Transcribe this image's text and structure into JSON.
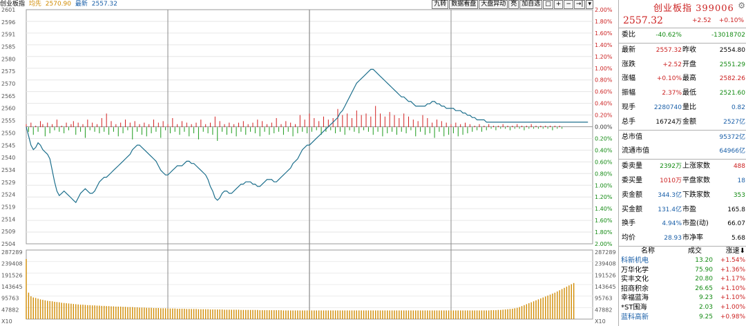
{
  "header": {
    "index_label": "创业板指",
    "prev_label": "均先",
    "prev_value": "2570.90",
    "latest_label": "最新",
    "latest_value": "2557.32"
  },
  "toolbar": [
    "九转",
    "数据看盘",
    "大盘异动",
    "亮",
    "加自选",
    "□",
    "+",
    "−",
    "→|",
    "▾"
  ],
  "axis": {
    "price_ticks": [
      "2601",
      "2596",
      "2591",
      "2585",
      "2580",
      "2575",
      "2570",
      "2565",
      "2560",
      "2555",
      "2550",
      "2545",
      "2540",
      "2534",
      "2529",
      "2524",
      "2519",
      "2514",
      "2509",
      "2504"
    ],
    "pct_left": [
      "2.00%",
      "1.80%",
      "1.60%",
      "1.40%",
      "1.20%",
      "1.00%",
      "0.80%",
      "0.60%",
      "0.40%",
      "0.20%",
      "0.00%",
      "0.20%",
      "0.40%",
      "0.60%",
      "0.80%",
      "1.00%",
      "1.20%",
      "1.40%",
      "1.60%",
      "1.80%",
      "2.00%"
    ],
    "vol_ticks": [
      "287289",
      "239408",
      "191526",
      "143645",
      "95763",
      "47882",
      "X10"
    ]
  },
  "chart_data": {
    "type": "line",
    "title": "",
    "x_range_points": 241,
    "ylim": [
      2504,
      2606
    ],
    "prev_close": 2554.8,
    "volume_ylim": [
      0,
      287289
    ],
    "series": [
      {
        "values": [
          2555,
          2551,
          2547,
          2545,
          2546,
          2548,
          2547,
          2545,
          2544,
          2543,
          2541,
          2536,
          2531,
          2527,
          2525,
          2526,
          2527,
          2526,
          2525,
          2524,
          2523,
          2522,
          2524,
          2526,
          2527,
          2528,
          2527,
          2526,
          2526,
          2527,
          2529,
          2531,
          2532,
          2533,
          2533,
          2534,
          2535,
          2536,
          2537,
          2538,
          2539,
          2540,
          2541,
          2542,
          2543,
          2545,
          2546,
          2547,
          2547,
          2546,
          2545,
          2544,
          2543,
          2542,
          2541,
          2540,
          2538,
          2536,
          2535,
          2534,
          2534,
          2535,
          2536,
          2537,
          2538,
          2538,
          2538,
          2539,
          2540,
          2540,
          2539,
          2539,
          2538,
          2537,
          2536,
          2535,
          2534,
          2532,
          2529,
          2527,
          2524,
          2523,
          2524,
          2526,
          2527,
          2527,
          2526,
          2526,
          2527,
          2528,
          2529,
          2530,
          2530,
          2531,
          2531,
          2531,
          2530,
          2530,
          2529,
          2529,
          2530,
          2531,
          2532,
          2532,
          2532,
          2531,
          2531,
          2532,
          2533,
          2534,
          2535,
          2536,
          2537,
          2539,
          2540,
          2541,
          2543,
          2545,
          2546,
          2547,
          2547,
          2548,
          2549,
          2550,
          2551,
          2552,
          2553,
          2554,
          2555,
          2556,
          2557,
          2558,
          2559,
          2561,
          2562,
          2564,
          2566,
          2568,
          2570,
          2572,
          2574,
          2575,
          2576,
          2577,
          2578,
          2579,
          2580,
          2580,
          2579,
          2578,
          2577,
          2576,
          2575,
          2574,
          2573,
          2572,
          2571,
          2570,
          2569,
          2568,
          2568,
          2567,
          2566,
          2566,
          2565,
          2564,
          2564,
          2564,
          2564,
          2564,
          2565,
          2565,
          2566,
          2566,
          2565,
          2565,
          2564,
          2564,
          2563,
          2563,
          2563,
          2563,
          2562,
          2562,
          2562,
          2561,
          2561,
          2560,
          2560,
          2559,
          2559,
          2558,
          2558,
          2558,
          2558,
          2557,
          2557,
          2557,
          2557,
          2557,
          2557,
          2557,
          2557,
          2557,
          2557,
          2557,
          2557,
          2557,
          2557,
          2557,
          2557,
          2557,
          2557,
          2557,
          2557,
          2557,
          2557,
          2557,
          2557,
          2557,
          2557,
          2557,
          2557,
          2557,
          2557,
          2557,
          2557,
          2557,
          2557,
          2557,
          2557,
          2557,
          2557,
          2557,
          2557,
          2557,
          2557,
          2557,
          2557
        ]
      }
    ],
    "breadth_bars": [
      2,
      -3,
      3,
      -5,
      1,
      -3,
      4,
      2,
      -6,
      3,
      -4,
      2,
      -2,
      5,
      -3,
      1,
      -4,
      3,
      -2,
      2,
      4,
      -5,
      3,
      -3,
      2,
      -7,
      5,
      -2,
      3,
      -3,
      2,
      -4,
      6,
      -3,
      9,
      -5,
      4,
      -3,
      2,
      -6,
      3,
      -4,
      5,
      -2,
      3,
      -8,
      4,
      -3,
      2,
      -5,
      3,
      -6,
      2,
      -4,
      5,
      -3,
      3,
      -7,
      4,
      -2,
      2,
      -4,
      6,
      -3,
      2,
      -5,
      4,
      -3,
      3,
      -6,
      2,
      -4,
      3,
      -8,
      5,
      -3,
      2,
      -4,
      3,
      -5,
      7,
      -9,
      4,
      -3,
      2,
      -5,
      3,
      -4,
      2,
      -6,
      3,
      -3,
      4,
      -5,
      2,
      -3,
      3,
      -4,
      5,
      -6,
      4,
      -3,
      2,
      -5,
      3,
      -4,
      6,
      -3,
      2,
      -5,
      4,
      -3,
      3,
      -6,
      2,
      -4,
      8,
      -3,
      5,
      -4,
      9,
      -3,
      6,
      -2,
      4,
      -5,
      7,
      -3,
      5,
      -2,
      6,
      -4,
      12,
      -3,
      8,
      -5,
      9,
      -2,
      6,
      -3,
      11,
      -4,
      8,
      -2,
      9,
      -3,
      7,
      -5,
      14,
      -3,
      9,
      -6,
      7,
      -4,
      10,
      -3,
      8,
      -5,
      6,
      -3,
      9,
      -4,
      7,
      -2,
      5,
      -6,
      4,
      -3,
      8,
      -5,
      6,
      -4,
      3,
      -7,
      5,
      -3,
      4,
      -6,
      3,
      -5,
      2,
      -4,
      3,
      -6,
      2,
      -5,
      3,
      -4,
      2,
      -3,
      1,
      -2,
      2,
      -3,
      1,
      -2,
      2,
      -1,
      1,
      -2,
      1,
      -1,
      2,
      -1,
      1,
      -2,
      1,
      -1,
      2,
      -1,
      1,
      -2,
      1,
      -1,
      2,
      -1,
      1,
      -1,
      1,
      -1,
      1,
      -1,
      1,
      -2,
      1,
      -1,
      1,
      -1
    ],
    "volumes": [
      250000,
      110000,
      95000,
      90000,
      88000,
      85000,
      82000,
      80000,
      78000,
      76000,
      75000,
      74000,
      72000,
      71000,
      70000,
      68000,
      67000,
      66000,
      65000,
      64000,
      63000,
      62000,
      61000,
      60000,
      60000,
      59000,
      58000,
      58000,
      57000,
      57000,
      56000,
      56000,
      55000,
      55000,
      54000,
      54000,
      53000,
      53000,
      52000,
      52000,
      52000,
      51000,
      51000,
      50000,
      50000,
      50000,
      49000,
      49000,
      48000,
      48000,
      48000,
      47000,
      47000,
      47000,
      46000,
      46000,
      46000,
      45000,
      45000,
      45000,
      44000,
      44000,
      44000,
      44000,
      43000,
      43000,
      43000,
      43000,
      42000,
      42000,
      42000,
      42000,
      42000,
      41000,
      41000,
      41000,
      41000,
      41000,
      40000,
      40000,
      40000,
      40000,
      40000,
      40000,
      39000,
      39000,
      39000,
      39000,
      39000,
      39000,
      39000,
      38000,
      38000,
      38000,
      38000,
      38000,
      38000,
      38000,
      38000,
      37000,
      37000,
      37000,
      37000,
      37000,
      37000,
      37000,
      37000,
      37000,
      37000,
      36000,
      36000,
      36000,
      36000,
      36000,
      36000,
      36000,
      36000,
      36000,
      36000,
      36000,
      36000,
      36000,
      36000,
      36000,
      36000,
      36000,
      36000,
      36000,
      36000,
      36000,
      36000,
      36000,
      36000,
      36000,
      36000,
      36000,
      36000,
      36000,
      36000,
      36000,
      36000,
      36000,
      36000,
      36000,
      36000,
      36000,
      36000,
      36000,
      36000,
      36000,
      36000,
      36000,
      36000,
      36000,
      36000,
      36000,
      36000,
      36000,
      36000,
      36000,
      36000,
      36000,
      36000,
      36000,
      36000,
      36000,
      36000,
      36000,
      36000,
      36000,
      36000,
      36000,
      36000,
      36000,
      36000,
      36000,
      36000,
      36000,
      36000,
      36000,
      36000,
      36000,
      36000,
      36000,
      36000,
      36000,
      36000,
      36000,
      36000,
      36000,
      36000,
      36000,
      36000,
      36000,
      36000,
      36000,
      36000,
      37000,
      37000,
      37000,
      38000,
      38000,
      39000,
      40000,
      41000,
      42000,
      43000,
      45000,
      47000,
      50000,
      54000,
      58000,
      62000,
      66000,
      70000,
      74000,
      78000,
      82000,
      86000,
      90000,
      94000,
      98000,
      102000,
      106000,
      110000,
      115000,
      120000,
      125000,
      130000,
      135000,
      140000,
      145000,
      150000
    ]
  },
  "panel": {
    "title": "创业板指 399006",
    "last": "2557.32",
    "change": "+2.52",
    "change_pct": "+0.10%",
    "weibi_label": "委比",
    "weibi_pct": "-40.62%",
    "weibi_val": "-13018702",
    "rows1": [
      {
        "l1": "最新",
        "v1": "2557.32",
        "c1": "red",
        "l2": "昨收",
        "v2": "2554.80",
        "c2": "blk"
      },
      {
        "l1": "涨跌",
        "v1": "+2.52",
        "c1": "red",
        "l2": "开盘",
        "v2": "2551.29",
        "c2": "green"
      },
      {
        "l1": "涨幅",
        "v1": "+0.10%",
        "c1": "red",
        "l2": "最高",
        "v2": "2582.26",
        "c2": "red"
      },
      {
        "l1": "振幅",
        "v1": "2.37%",
        "c1": "red",
        "l2": "最低",
        "v2": "2521.60",
        "c2": "green"
      },
      {
        "l1": "现手",
        "v1": "2280740",
        "c1": "blue",
        "l2": "量比",
        "v2": "0.82",
        "c2": "blue"
      },
      {
        "l1": "总手",
        "v1": "16724万",
        "c1": "blk",
        "l2": "金额",
        "v2": "2527亿",
        "c2": "blue"
      }
    ],
    "market_cap_label": "总市值",
    "market_cap": "95372亿",
    "float_cap_label": "流通市值",
    "float_cap": "64966亿",
    "rows2": [
      {
        "l1": "委卖量",
        "v1": "2392万",
        "c1": "green",
        "l2": "上涨家数",
        "v2": "488",
        "c2": "red"
      },
      {
        "l1": "委买量",
        "v1": "1010万",
        "c1": "red",
        "l2": "平盘家数",
        "v2": "18",
        "c2": "blue"
      },
      {
        "l1": "卖金额",
        "v1": "344.3亿",
        "c1": "blue",
        "l2": "下跌家数",
        "v2": "353",
        "c2": "green"
      },
      {
        "l1": "买金额",
        "v1": "131.4亿",
        "c1": "blue",
        "l2": "市盈",
        "v2": "165.8",
        "c2": "blk"
      },
      {
        "l1": "换手",
        "v1": "4.94%",
        "c1": "blue",
        "l2": "市盈(动)",
        "v2": "66.07",
        "c2": "blk"
      },
      {
        "l1": "均价",
        "v1": "28.93",
        "c1": "blue",
        "l2": "市净率",
        "v2": "5.68",
        "c2": "blk"
      }
    ],
    "list_head": {
      "name": "名称",
      "price": "成交",
      "change": "涨速"
    },
    "list": [
      {
        "name": "科新机电",
        "price": "13.20",
        "change": "+1.54%",
        "nc": "blue"
      },
      {
        "name": "万华化学",
        "price": "75.90",
        "change": "+1.36%",
        "nc": "blk"
      },
      {
        "name": "实丰文化",
        "price": "20.80",
        "change": "+1.17%",
        "nc": "blk"
      },
      {
        "name": "招商积余",
        "price": "26.65",
        "change": "+1.10%",
        "nc": "blk"
      },
      {
        "name": "幸福蓝海",
        "price": "9.23",
        "change": "+1.10%",
        "nc": "blk"
      },
      {
        "name": "*ST围海",
        "price": "2.03",
        "change": "+1.00%",
        "nc": "blk"
      },
      {
        "name": "蓝科高新",
        "price": "9.25",
        "change": "+0.98%",
        "nc": "blue"
      }
    ]
  }
}
